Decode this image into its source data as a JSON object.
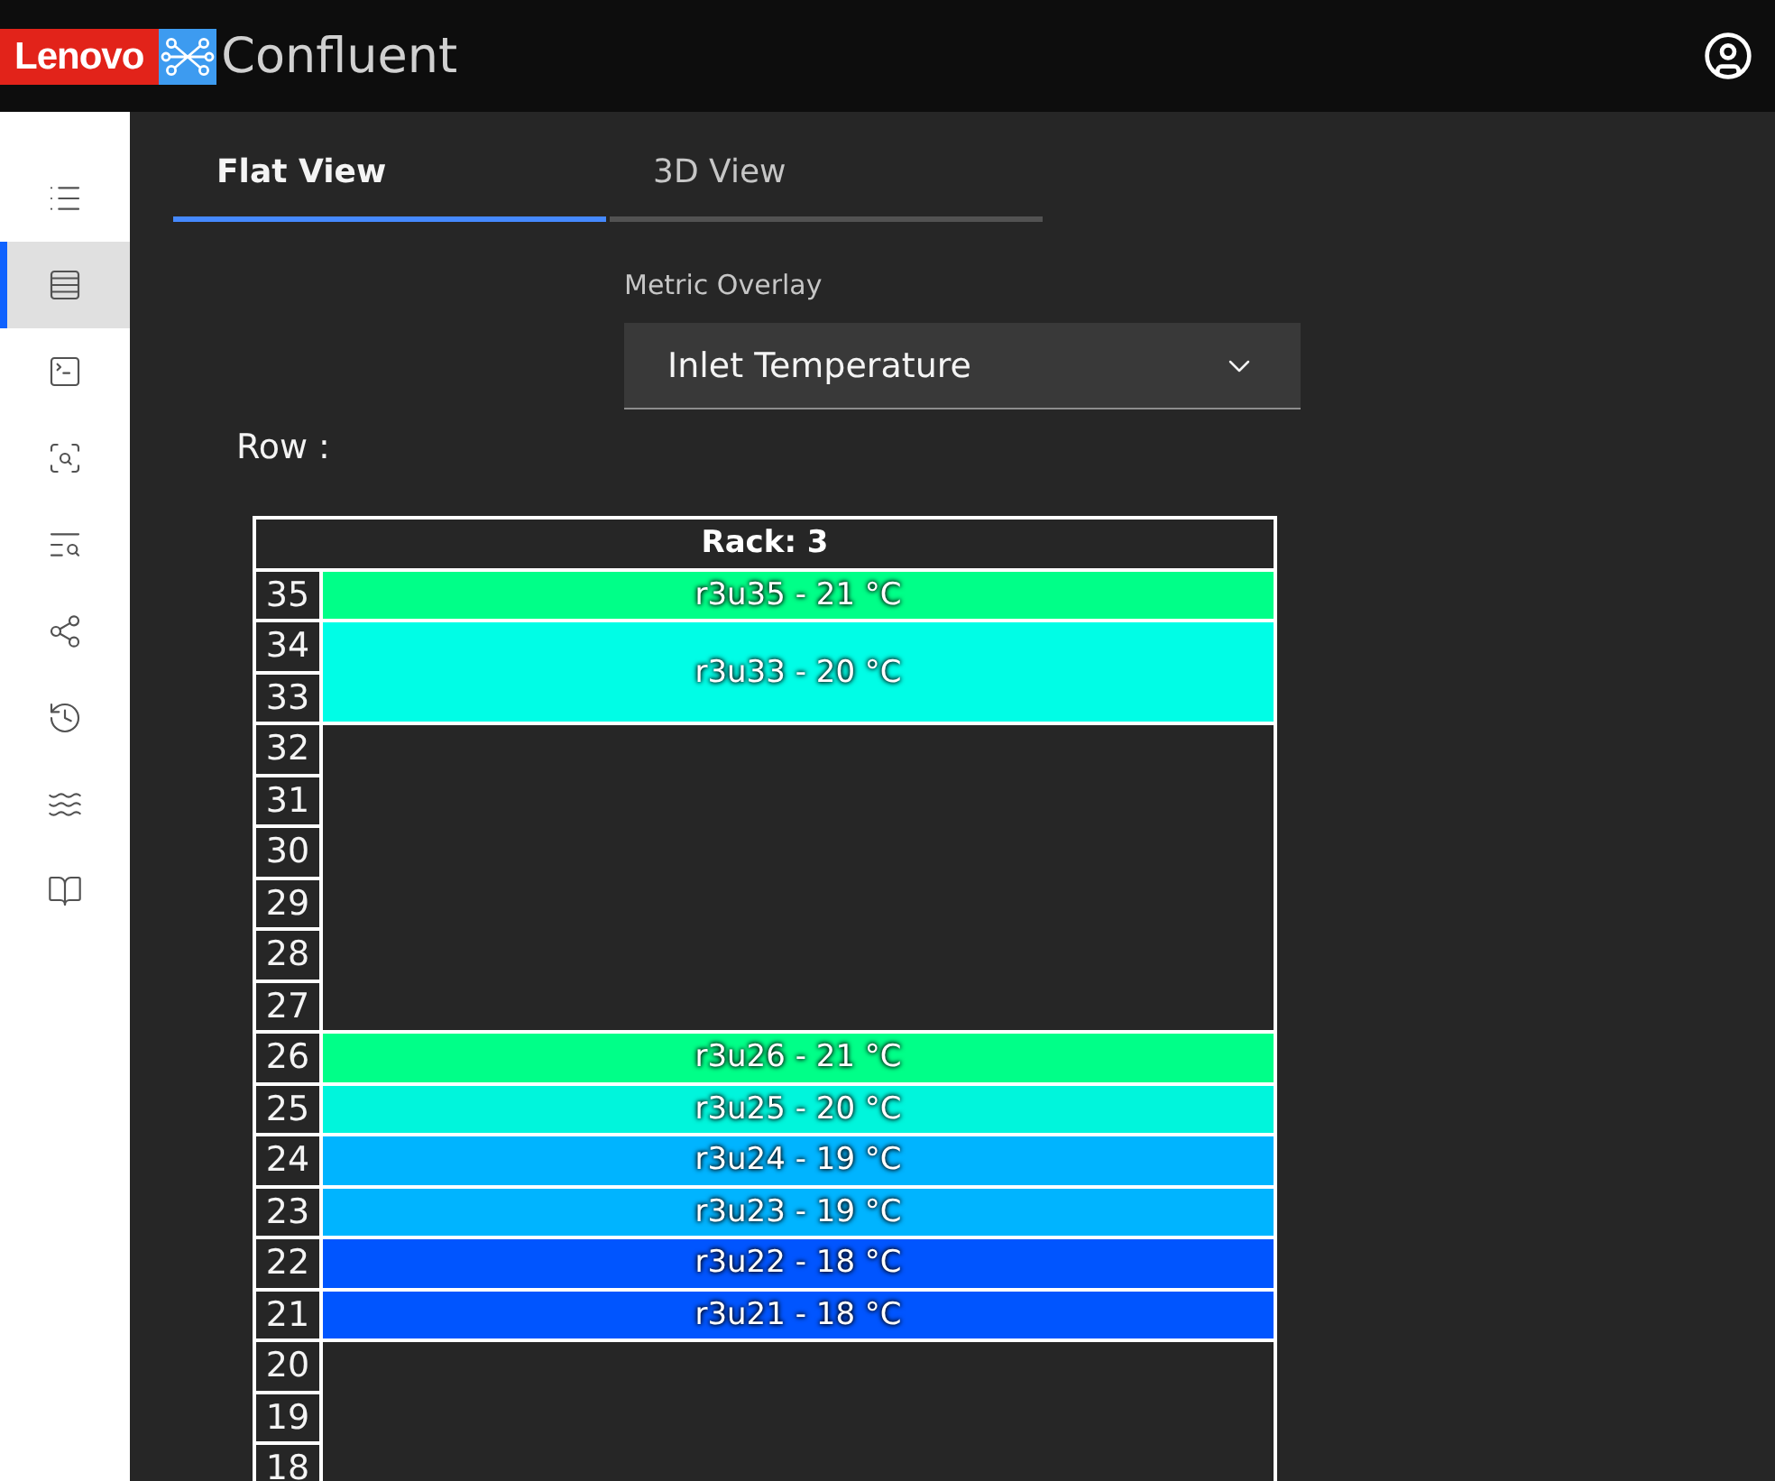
{
  "header": {
    "brand": "Lenovo",
    "product": "Confluent"
  },
  "sidebar": {
    "items": [
      {
        "selected": false
      },
      {
        "selected": true
      },
      {
        "selected": false
      },
      {
        "selected": false
      },
      {
        "selected": false
      },
      {
        "selected": false
      },
      {
        "selected": false
      },
      {
        "selected": false
      },
      {
        "selected": false
      }
    ]
  },
  "tabs": [
    {
      "label": "Flat View",
      "selected": true
    },
    {
      "label": "3D View",
      "selected": false
    }
  ],
  "metric_overlay": {
    "label": "Metric Overlay",
    "value": "Inlet Temperature"
  },
  "row_label": "Row :",
  "rack": {
    "title": "Rack: 3",
    "slots": [
      {
        "kind": "node",
        "units": [
          "35"
        ],
        "label": "r3u35 - 21 °C",
        "color": "#00ff88"
      },
      {
        "kind": "node",
        "units": [
          "34",
          "33"
        ],
        "label": "r3u33 - 20 °C",
        "color": "#00fde6"
      },
      {
        "kind": "empty",
        "units": [
          "32",
          "31",
          "30",
          "29",
          "28",
          "27"
        ]
      },
      {
        "kind": "node",
        "units": [
          "26"
        ],
        "label": "r3u26 - 21 °C",
        "color": "#00ff88"
      },
      {
        "kind": "node",
        "units": [
          "25"
        ],
        "label": "r3u25 - 20 °C",
        "color": "#00f5dc"
      },
      {
        "kind": "node",
        "units": [
          "24"
        ],
        "label": "r3u24 - 19 °C",
        "color": "#00b4ff"
      },
      {
        "kind": "node",
        "units": [
          "23"
        ],
        "label": "r3u23 - 19 °C",
        "color": "#00b4ff"
      },
      {
        "kind": "node",
        "units": [
          "22"
        ],
        "label": "r3u22 - 18 °C",
        "color": "#0055ff"
      },
      {
        "kind": "node",
        "units": [
          "21"
        ],
        "label": "r3u21 - 18 °C",
        "color": "#0055ff"
      },
      {
        "kind": "empty",
        "units": [
          "20",
          "19",
          "18"
        ]
      }
    ]
  }
}
